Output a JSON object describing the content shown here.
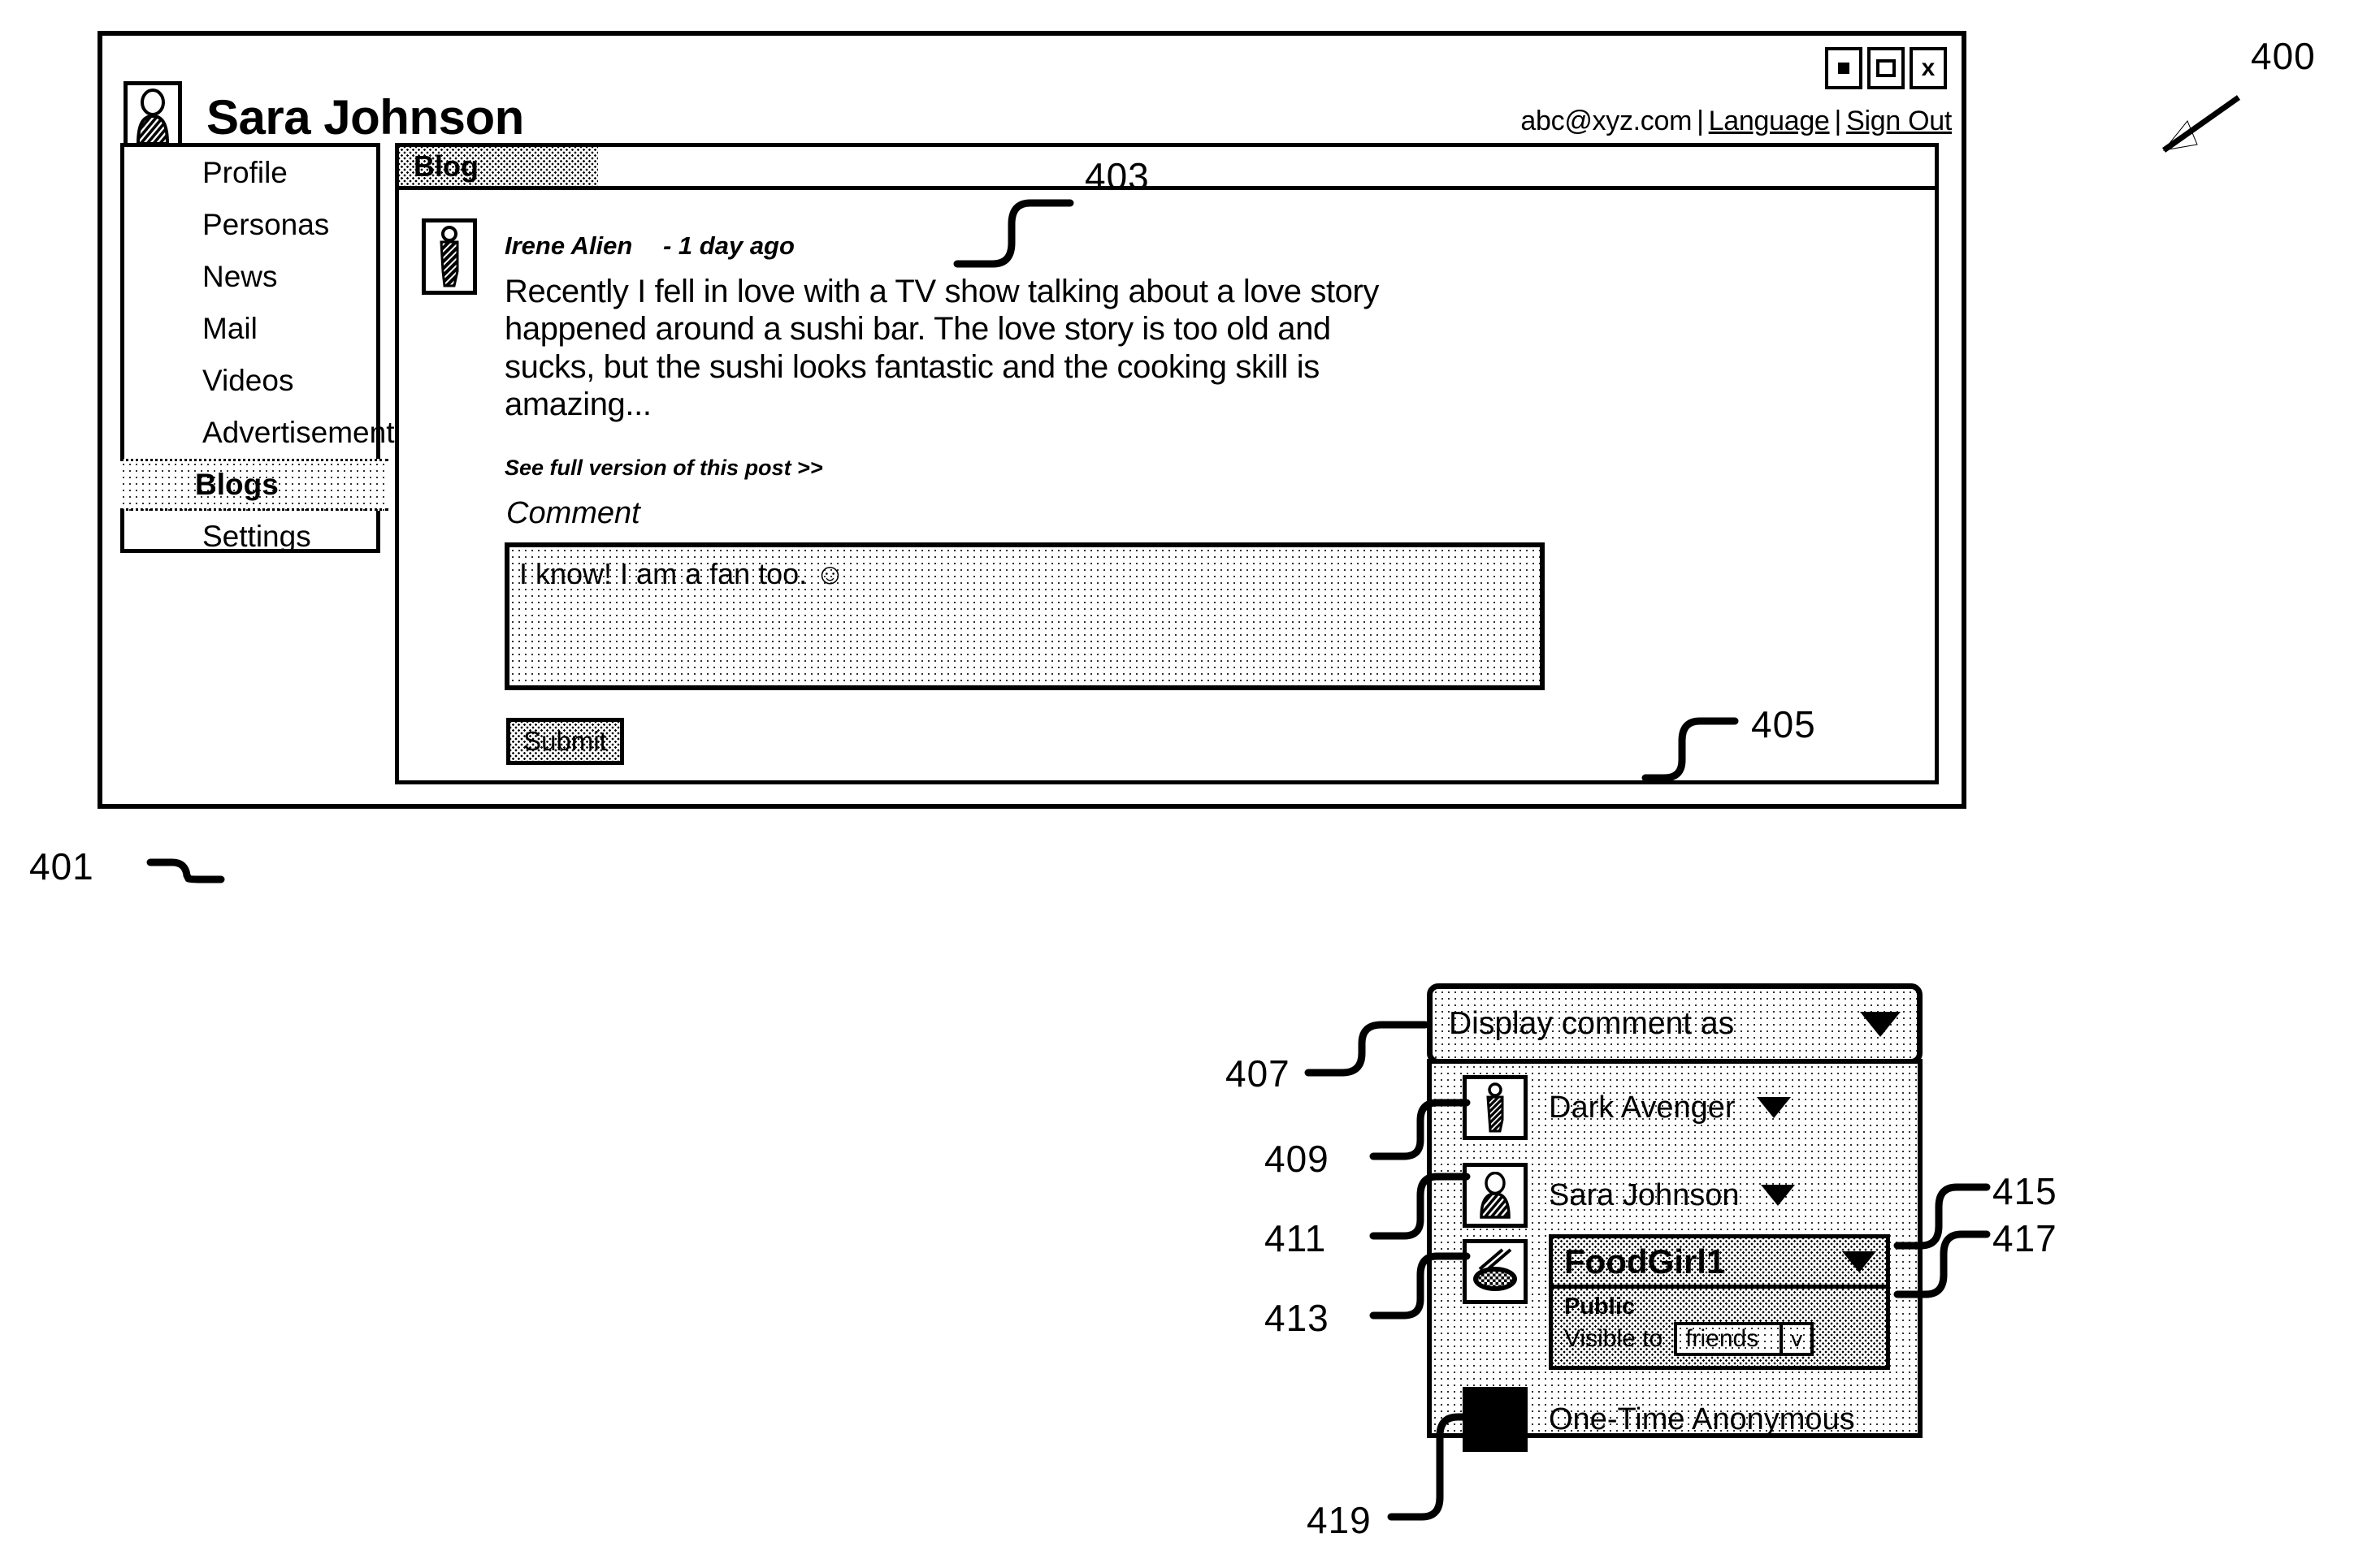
{
  "window": {
    "controls": [
      {
        "name": "minimize",
        "label": "-"
      },
      {
        "name": "maximize",
        "label": "□"
      },
      {
        "name": "close",
        "label": "x"
      }
    ],
    "account": {
      "email": "abc@xyz.com",
      "language_link": "Language",
      "signout_link": "Sign Out",
      "separator": "|"
    }
  },
  "header": {
    "user_name": "Sara Johnson",
    "avatar_icon": "person-avatar-icon"
  },
  "sidebar": {
    "items": [
      {
        "label": "Profile",
        "selected": false
      },
      {
        "label": "Personas",
        "selected": false
      },
      {
        "label": "News",
        "selected": false
      },
      {
        "label": "Mail",
        "selected": false
      },
      {
        "label": "Videos",
        "selected": false
      },
      {
        "label": "Advertisements",
        "selected": false
      },
      {
        "label": "Blogs",
        "selected": true
      },
      {
        "label": "Settings",
        "selected": false
      }
    ]
  },
  "content": {
    "tab_label": "Blog",
    "post": {
      "avatar_icon": "dark-figure-avatar-icon",
      "author": "Irene Alien",
      "timestamp": "- 1 day ago",
      "body": "Recently I fell in love with a TV show talking about a love story happened around a sushi bar.  The love story is too old and sucks, but the sushi looks fantastic and the cooking skill is amazing...",
      "read_more": "See full version of this post >>"
    },
    "comment": {
      "label": "Comment",
      "value": "I know!  I am a fan too. ☺",
      "submit_label": "Submit"
    }
  },
  "persona_dropdown": {
    "header_label": "Display comment as",
    "header_caret_icon": "chevron-down-icon",
    "options": [
      {
        "label": "Dark Avenger",
        "icon": "dark-figure-avatar-icon",
        "has_caret": true,
        "expanded": false
      },
      {
        "label": "Sara Johnson",
        "icon": "person-avatar-icon",
        "has_caret": true,
        "expanded": false
      },
      {
        "label": "FoodGirl1",
        "icon": "sushi-avatar-icon",
        "has_caret": true,
        "expanded": true,
        "visibility_title": "Public",
        "visible_to_label": "Visible to",
        "visible_to_value": "friends",
        "visible_to_caret": "ⅴ"
      },
      {
        "label": "One-Time Anonymous",
        "icon": "solid-black-square-icon",
        "has_caret": false,
        "expanded": false
      }
    ]
  },
  "reference_numerals": {
    "n400": "400",
    "n401": "401",
    "n403": "403",
    "n405": "405",
    "n407": "407",
    "n409": "409",
    "n411": "411",
    "n413": "413",
    "n415": "415",
    "n417": "417",
    "n419": "419"
  }
}
